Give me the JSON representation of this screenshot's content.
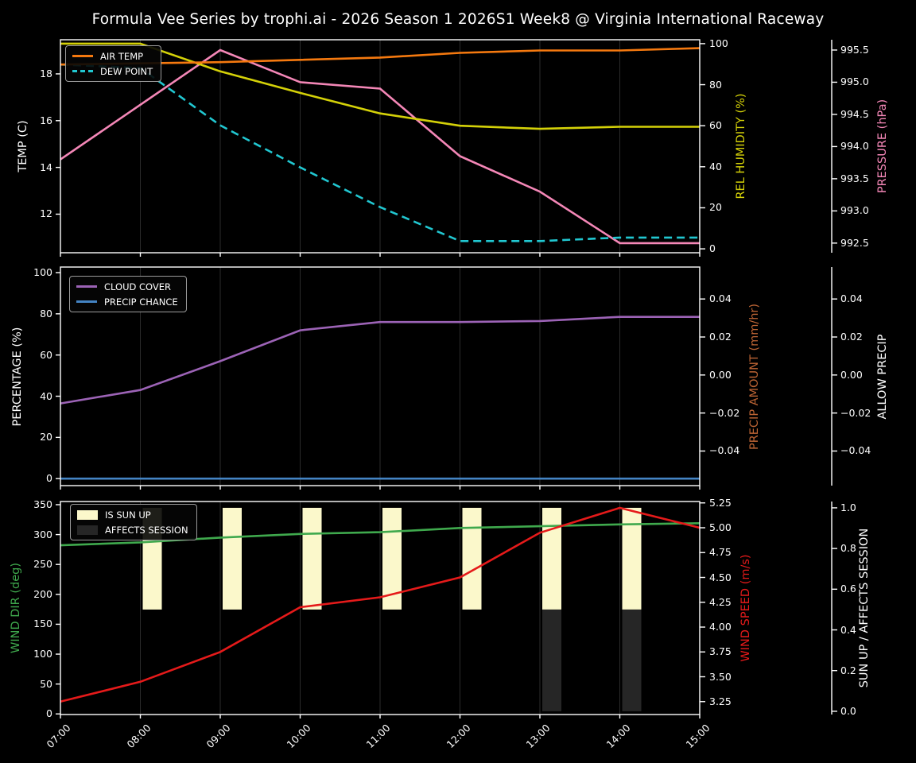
{
  "title": "Formula Vee Series by trophi.ai - 2026 Season 1 2026S1 Week8 @ Virginia International Raceway",
  "x_labels": [
    "07:00",
    "08:00",
    "09:00",
    "10:00",
    "11:00",
    "12:00",
    "13:00",
    "14:00",
    "15:00"
  ],
  "chart_data": [
    {
      "panel": "temperature-humidity-pressure",
      "type": "line",
      "x": [
        "07:00",
        "08:00",
        "09:00",
        "10:00",
        "11:00",
        "12:00",
        "13:00",
        "14:00",
        "15:00"
      ],
      "series": [
        {
          "name": "AIR TEMP",
          "axis": "temp",
          "color": "#f5790f",
          "style": "solid",
          "z": 4,
          "values": [
            18.4,
            18.45,
            18.5,
            18.6,
            18.7,
            18.9,
            19.0,
            19.0,
            19.1
          ]
        },
        {
          "name": "DEW POINT",
          "axis": "temp",
          "color": "#21c7d1",
          "style": "dashed",
          "z": 3,
          "values": [
            18.4,
            18.25,
            15.8,
            14.0,
            12.3,
            10.85,
            10.85,
            11.0,
            11.0
          ]
        },
        {
          "name": "REL HUMIDITY",
          "axis": "humidity",
          "color": "#d4d108",
          "style": "solid",
          "z": 2,
          "values": [
            100,
            100,
            86.5,
            76,
            66,
            60,
            58.5,
            59.5,
            59.5
          ]
        },
        {
          "name": "PRESSURE",
          "axis": "pressure",
          "color": "#f487b7",
          "style": "solid",
          "z": 1,
          "values": [
            993.8,
            994.65,
            995.5,
            995.0,
            994.9,
            993.85,
            993.3,
            992.5,
            992.5
          ]
        }
      ],
      "axes": {
        "temp": {
          "label": "TEMP (C)",
          "color": "#ffffff",
          "side": "left",
          "decimals": 0,
          "ticks": [
            12,
            14,
            16,
            18
          ],
          "range": [
            10.35,
            19.46
          ]
        },
        "humidity": {
          "label": "REL HUMIDITY (%)",
          "color": "#d4d108",
          "side": "right",
          "decimals": 0,
          "ticks": [
            0,
            20,
            40,
            60,
            80,
            100
          ],
          "range": [
            -1.9,
            101.9
          ]
        },
        "pressure": {
          "label": "PRESSURE (hPa)",
          "color": "#f487b7",
          "side": "right2",
          "decimals": 1,
          "ticks": [
            992.5,
            993.0,
            993.5,
            994.0,
            994.5,
            995.0,
            995.5
          ],
          "range": [
            992.35,
            995.66
          ]
        }
      },
      "legend": [
        "AIR TEMP",
        "DEW POINT"
      ]
    },
    {
      "panel": "cloud-precip",
      "type": "line",
      "x": [
        "07:00",
        "08:00",
        "09:00",
        "10:00",
        "11:00",
        "12:00",
        "13:00",
        "14:00",
        "15:00"
      ],
      "series": [
        {
          "name": "CLOUD COVER",
          "axis": "percentage",
          "color": "#9c63b6",
          "style": "solid",
          "z": 2,
          "values": [
            36.5,
            43,
            57,
            72,
            76,
            76,
            76.5,
            78.5,
            78.5
          ]
        },
        {
          "name": "PRECIP CHANCE",
          "axis": "percentage",
          "color": "#4484c4",
          "style": "solid",
          "z": 1,
          "values": [
            0,
            0,
            0,
            0,
            0,
            0,
            0,
            0,
            0
          ]
        }
      ],
      "axes": {
        "percentage": {
          "label": "PERCENTAGE (%)",
          "color": "#ffffff",
          "side": "left",
          "decimals": 0,
          "ticks": [
            0,
            20,
            40,
            60,
            80,
            100
          ],
          "range": [
            -3.4,
            102.7
          ]
        },
        "precip_amount": {
          "label": "PRECIP AMOUNT (mm/hr)",
          "color": "#bc6434",
          "side": "right",
          "decimals": 2,
          "ticks": [
            -0.04,
            -0.02,
            0.0,
            0.02,
            0.04
          ],
          "range": [
            -0.0582,
            0.0568
          ]
        },
        "allow_precip": {
          "label": "ALLOW PRECIP",
          "color": "#ffffff",
          "side": "right2",
          "decimals": 2,
          "ticks": [
            -0.04,
            -0.02,
            0.0,
            0.02,
            0.04
          ],
          "range": [
            -0.0582,
            0.0568
          ]
        }
      },
      "legend": [
        "CLOUD COVER",
        "PRECIP CHANCE"
      ]
    },
    {
      "panel": "wind-sun",
      "type": "line+bar",
      "x": [
        "07:00",
        "08:00",
        "09:00",
        "10:00",
        "11:00",
        "12:00",
        "13:00",
        "14:00",
        "15:00"
      ],
      "bars": [
        {
          "name": "IS SUN UP",
          "axis": "sun",
          "color": "#fbf8cb",
          "value": 1,
          "span": [
            0.5,
            1.0
          ],
          "hours": [
            "08:00",
            "09:00",
            "10:00",
            "11:00",
            "12:00",
            "13:00",
            "14:00"
          ]
        },
        {
          "name": "AFFECTS SESSION",
          "axis": "sun",
          "color": "#262626",
          "value": 1,
          "span": [
            0.0,
            0.5
          ],
          "hours": [
            "13:00",
            "14:00"
          ]
        }
      ],
      "series": [
        {
          "name": "WIND DIR",
          "axis": "wind_dir",
          "color": "#3fa94d",
          "style": "solid",
          "z": 1,
          "values": [
            282,
            287,
            295,
            301,
            304,
            311,
            314,
            317,
            319
          ]
        },
        {
          "name": "WIND SPEED",
          "axis": "wind_speed",
          "color": "#e51a1a",
          "style": "solid",
          "z": 2,
          "values": [
            3.25,
            3.45,
            3.75,
            4.2,
            4.3,
            4.5,
            4.95,
            5.2,
            5.0
          ]
        }
      ],
      "axes": {
        "wind_dir": {
          "label": "WIND DIR (deg)",
          "color": "#3fa94d",
          "side": "left",
          "decimals": 0,
          "ticks": [
            0,
            50,
            100,
            150,
            200,
            250,
            300,
            350
          ],
          "range": [
            -1,
            355.3
          ]
        },
        "wind_speed": {
          "label": "WIND SPEED (m/s)",
          "color": "#e51a1a",
          "side": "right",
          "decimals": 2,
          "ticks": [
            3.25,
            3.5,
            3.75,
            4.0,
            4.25,
            4.5,
            4.75,
            5.0,
            5.25
          ],
          "range": [
            3.12,
            5.264
          ]
        },
        "sun": {
          "label": "SUN UP / AFFECTS SESSION",
          "color": "#ffffff",
          "side": "right2",
          "decimals": 1,
          "ticks": [
            0.0,
            0.2,
            0.4,
            0.6,
            0.8,
            1.0
          ],
          "range": [
            -0.016,
            1.031
          ]
        }
      },
      "legend": [
        "IS SUN UP",
        "AFFECTS SESSION"
      ]
    }
  ],
  "style_colors": {
    "background": "#000000",
    "text": "#ffffff",
    "gridline": "#2b2b2b",
    "spine": "#ffffff"
  }
}
